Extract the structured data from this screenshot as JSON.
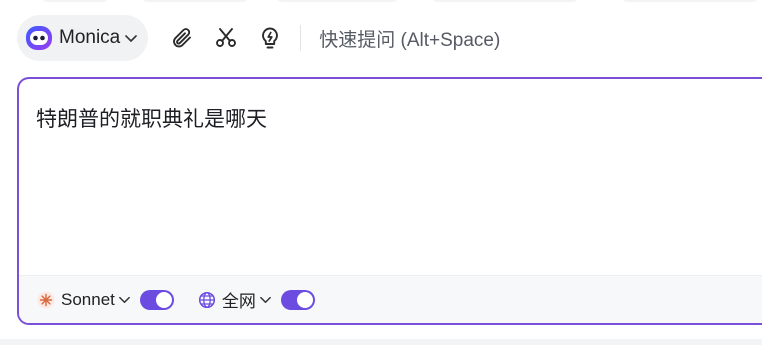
{
  "toolbar": {
    "model_name": "Monica",
    "model_logo_icon": "monica-logo-icon",
    "attach_icon": "paperclip-icon",
    "screenshot_icon": "scissors-icon",
    "prompt_icon": "lightbulb-icon",
    "quick_ask": "快速提问 (Alt+Space)"
  },
  "editor": {
    "prompt": "特朗普的就职典礼是哪天"
  },
  "footer": {
    "model_toggle": {
      "icon": "claude-sparkle-icon",
      "label": "Sonnet",
      "enabled": true
    },
    "web_toggle": {
      "icon": "globe-icon",
      "label": "全网",
      "enabled": true
    }
  },
  "colors": {
    "accent": "#6c4ce0",
    "editor_border": "#7b4fd8",
    "pill_bg": "#f1f2f4"
  }
}
